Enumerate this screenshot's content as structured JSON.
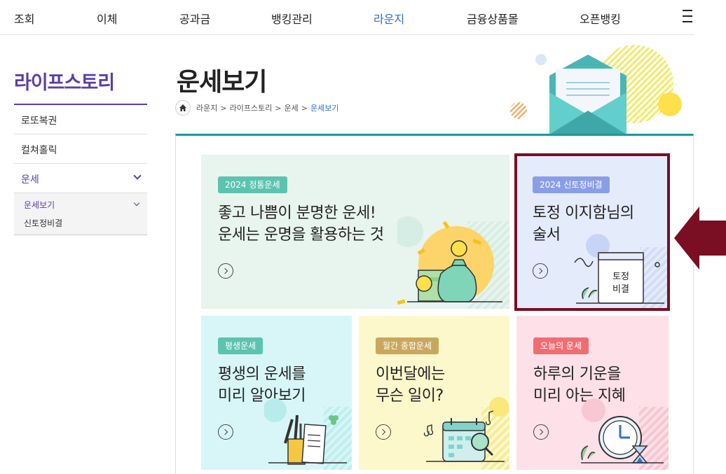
{
  "topnav": {
    "items": [
      "조회",
      "이체",
      "공과금",
      "뱅킹관리",
      "라운지",
      "금융상품몰",
      "오픈뱅킹"
    ],
    "active": "라운지",
    "menu_icon": "hamburger-icon"
  },
  "sidebar": {
    "title": "라이프스토리",
    "items": [
      "로또복권",
      "컬쳐홀릭",
      "운세"
    ],
    "sub_items": [
      "운세보기",
      "신토정비결"
    ]
  },
  "page": {
    "title": "운세보기",
    "breadcrumb": [
      "라운지",
      "라이프스토리",
      "운세",
      "운세보기"
    ],
    "breadcrumb_sep": ">"
  },
  "cards": [
    {
      "badge": "2024 정통운세",
      "lines": [
        "좋고 나쁨이 분명한 운세!",
        "운세는 운명을 활용하는 것"
      ],
      "bg": "#e8f4ee",
      "badge_color": "#5cc3b0",
      "icon": "money-bag-icon"
    },
    {
      "badge": "2024 신토정비결",
      "lines": [
        "토정 이지함님의",
        "술서"
      ],
      "bg": "#e4ebfb",
      "badge_color": "#8a9ee6",
      "icon": "book-icon",
      "book_label": [
        "토정",
        "비결"
      ]
    },
    {
      "badge": "평생운세",
      "lines": [
        "평생의 운세를",
        "미리 알아보기"
      ],
      "bg": "#d8f6f7",
      "badge_color": "#5cc3b0",
      "icon": "pencil-cup-icon"
    },
    {
      "badge": "월간 종합운세",
      "lines": [
        "이번달에는",
        "무슨 일이?"
      ],
      "bg": "#fdf8cc",
      "badge_color": "#c9a85d",
      "icon": "calendar-icon"
    },
    {
      "badge": "오늘의 운세",
      "lines": [
        "하루의 기운을",
        "미리 아는 지혜"
      ],
      "bg": "#fde0e8",
      "badge_color": "#ef6e73",
      "icon": "clock-icon"
    }
  ],
  "colors": {
    "accent_purple": "#5a3ea8",
    "active_blue": "#2f6fd6",
    "panel_teal": "#1a9a9a",
    "highlight": "#7a0e22"
  }
}
